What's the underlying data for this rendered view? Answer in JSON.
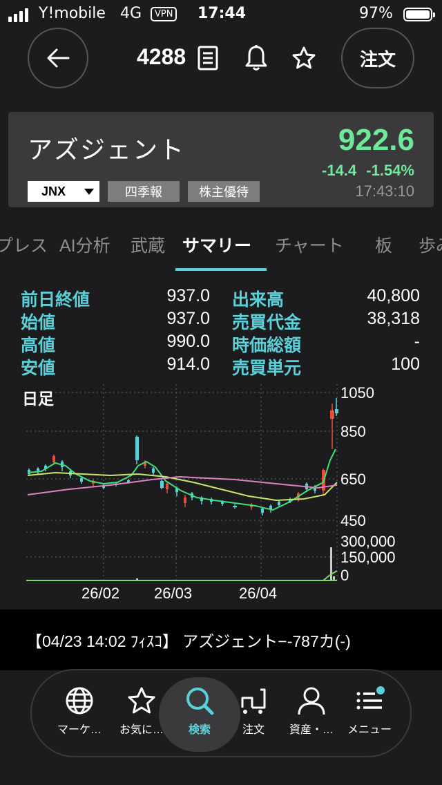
{
  "status": {
    "carrier": "Y!mobile",
    "network": "4G",
    "vpn": "VPN",
    "time": "17:44",
    "battery": "97%"
  },
  "nav": {
    "code": "4288",
    "order_label": "注文"
  },
  "quote": {
    "name": "アズジェント",
    "price": "922.6",
    "change": "-14.4  -1.54%",
    "time": "17:43:10",
    "market": "JNX",
    "pills": [
      "四季報",
      "株主優待"
    ],
    "price_color": "#6ee99a"
  },
  "tabs": [
    "プレス",
    "AI分析",
    "武蔵",
    "サマリー",
    "チャート",
    "板",
    "歩み"
  ],
  "active_tab": "サマリー",
  "summary": [
    {
      "label": "前日終値",
      "value": "937.0"
    },
    {
      "label": "出来高",
      "value": "40,800"
    },
    {
      "label": "始値",
      "value": "937.0"
    },
    {
      "label": "売買代金",
      "value": "38,318"
    },
    {
      "label": "高値",
      "value": "990.0"
    },
    {
      "label": "時価総額",
      "value": "-"
    },
    {
      "label": "安値",
      "value": "914.0"
    },
    {
      "label": "売買単元",
      "value": "100"
    }
  ],
  "chart": {
    "title": "日足",
    "price_ticks": [
      "1050",
      "850",
      "650",
      "450"
    ],
    "volume_ticks": [
      "300,000",
      "150,000",
      "0"
    ],
    "x_labels": [
      "26/02",
      "26/03",
      "26/04"
    ],
    "up_color": "#5ad1d9",
    "down_color": "#e74c3c"
  },
  "news": "【04/23 14:02 ﾌｨｽｺ】 アズジェント−-787カ(-)",
  "tabbar": [
    {
      "label": "マーケ…",
      "icon": "globe-icon"
    },
    {
      "label": "お気に…",
      "icon": "star-icon"
    },
    {
      "label": "検索",
      "icon": "search-icon"
    },
    {
      "label": "注文",
      "icon": "cart-icon"
    },
    {
      "label": "資産・…",
      "icon": "person-icon"
    },
    {
      "label": "メニュー",
      "icon": "menu-icon"
    }
  ]
}
